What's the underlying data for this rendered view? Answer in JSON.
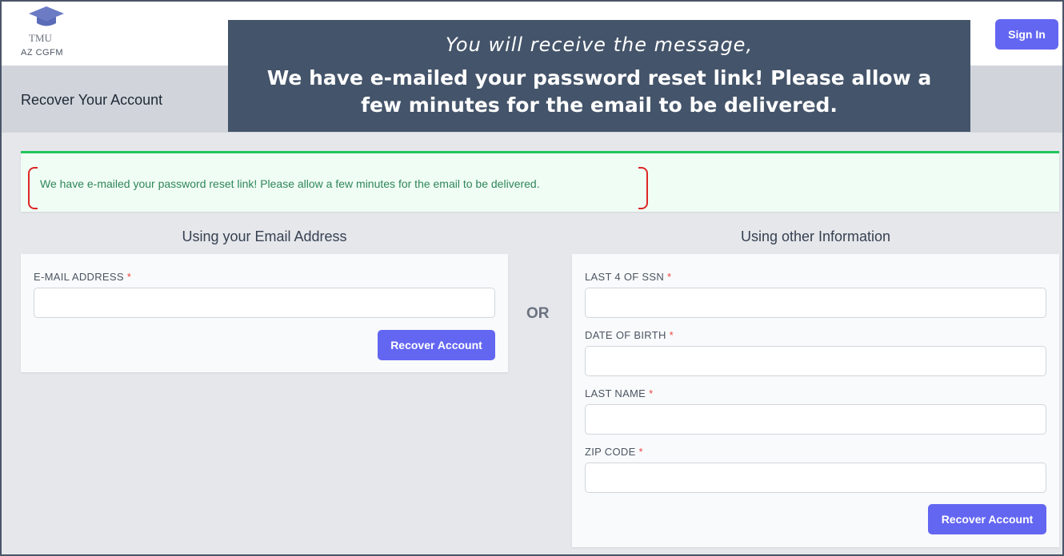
{
  "header": {
    "logo_text": "TMU",
    "org_text": "AZ CGFM",
    "signin_label": "Sign In"
  },
  "subheader": {
    "title": "Recover Your Account"
  },
  "callout": {
    "line1": "You will receive the message,",
    "line2": "We have e-mailed your password reset link!  Please allow a few minutes for the email to be delivered."
  },
  "alert": {
    "message": "We have e-mailed your password reset link! Please allow a few minutes for the email to be delivered."
  },
  "email_section": {
    "heading": "Using your Email Address",
    "email_label": "E-MAIL ADDRESS",
    "email_value": "",
    "button_label": "Recover Account"
  },
  "or_label": "OR",
  "info_section": {
    "heading": "Using other Information",
    "ssn_label": "LAST 4 OF SSN",
    "dob_label": "DATE OF BIRTH",
    "lastname_label": "LAST NAME",
    "zip_label": "ZIP CODE",
    "button_label": "Recover Account"
  },
  "required_marker": "*",
  "colors": {
    "accent": "#6366f1",
    "success_border": "#22c55e",
    "success_text": "#2f855a",
    "callout_bg": "#44546a",
    "required": "#ef4444",
    "highlight": "#dc2626"
  }
}
